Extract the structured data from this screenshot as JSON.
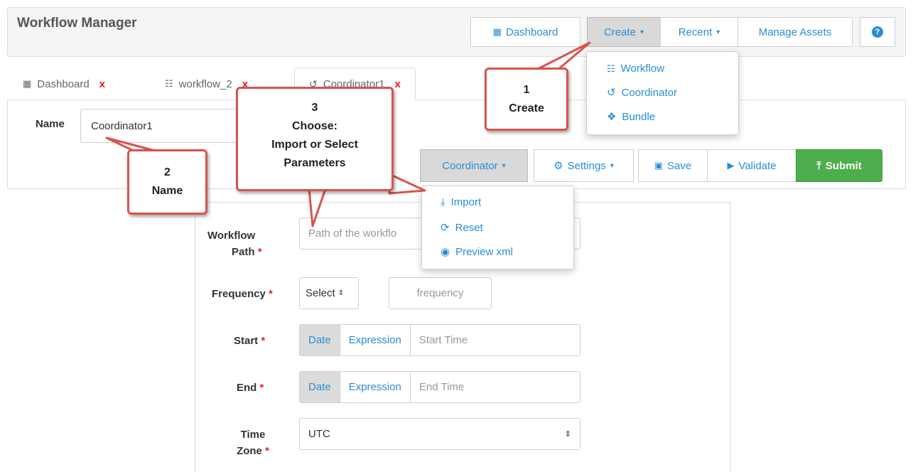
{
  "header": {
    "title": "Workflow Manager",
    "dashboard_label": "Dashboard",
    "create_label": "Create",
    "recent_label": "Recent",
    "manage_assets_label": "Manage Assets",
    "help_icon": "question-circle-icon"
  },
  "create_menu": {
    "items": [
      {
        "label": "Workflow",
        "icon": "sitemap-icon"
      },
      {
        "label": "Coordinator",
        "icon": "history-icon"
      },
      {
        "label": "Bundle",
        "icon": "cubes-icon"
      }
    ]
  },
  "tabs": [
    {
      "label": "Dashboard",
      "icon": "grid-icon",
      "close": "x"
    },
    {
      "label": "workflow_2",
      "icon": "sitemap-icon",
      "close": "x"
    },
    {
      "label": "Coordinator1",
      "icon": "history-icon",
      "close": "x"
    }
  ],
  "name": {
    "label": "Name",
    "value": "Coordinator1"
  },
  "toolbar": {
    "coordinator_label": "Coordinator",
    "settings_label": "Settings",
    "save_label": "Save",
    "validate_label": "Validate",
    "submit_label": "Submit"
  },
  "coordinator_menu": {
    "items": [
      {
        "label": "Import",
        "icon": "download-icon"
      },
      {
        "label": "Reset",
        "icon": "refresh-icon"
      },
      {
        "label": "Preview xml",
        "icon": "eye-icon"
      }
    ]
  },
  "form": {
    "workflow_path": {
      "label_line1": "Workflow",
      "label_line2": "Path",
      "placeholder": "Path of the workflo"
    },
    "frequency": {
      "label": "Frequency",
      "select_value": "Select",
      "placeholder": "frequency"
    },
    "start": {
      "label": "Start",
      "date": "Date",
      "expression": "Expression",
      "placeholder": "Start Time"
    },
    "end": {
      "label": "End",
      "date": "Date",
      "expression": "Expression",
      "placeholder": "End Time"
    },
    "timezone": {
      "label_line1": "Time",
      "label_line2": "Zone",
      "value": "UTC"
    },
    "required_mark": "*"
  },
  "callouts": {
    "c1": {
      "num": "1",
      "text": "Create"
    },
    "c2": {
      "num": "2",
      "text": "Name"
    },
    "c3": {
      "num": "3",
      "line1": "Choose:",
      "line2": "Import or Select",
      "line3": "Parameters"
    }
  },
  "colors": {
    "accent": "#2a8dd4",
    "callout_border": "#d9534f",
    "submit": "#4cae4c",
    "required": "#e02020"
  }
}
